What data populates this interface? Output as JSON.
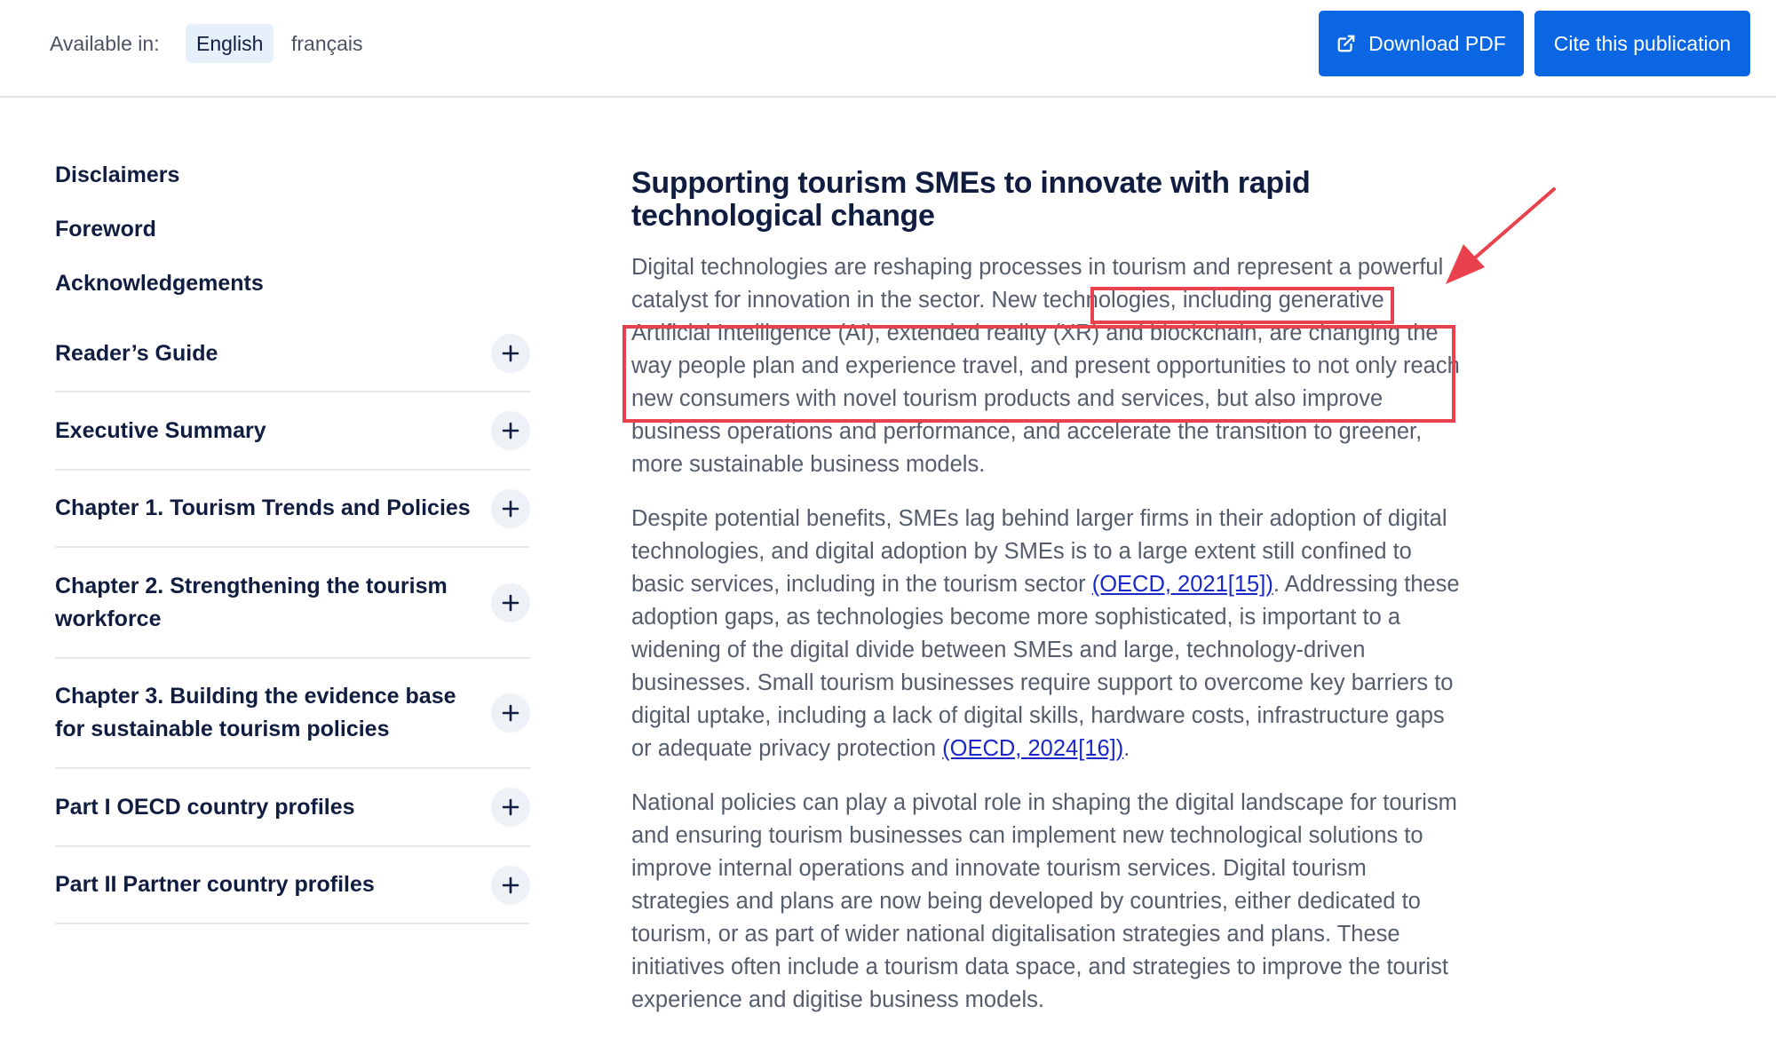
{
  "header": {
    "available_label": "Available in:",
    "languages": [
      "English",
      "français"
    ],
    "download_label": "Download PDF",
    "cite_label": "Cite this publication",
    "accent_color": "#0b66e4"
  },
  "sidebar": {
    "simple_items": [
      "Disclaimers",
      "Foreword",
      "Acknowledgements"
    ],
    "expandable_items": [
      "Reader’s Guide",
      "Executive Summary",
      "Chapter 1. Tourism Trends and Policies",
      "Chapter 2. Strengthening the tourism workforce",
      "Chapter 3. Building the evidence base for sustainable tourism policies",
      "Part I OECD country profiles",
      "Part II Partner country profiles"
    ],
    "expand_icon": "plus-icon"
  },
  "article": {
    "title": "Supporting tourism SMEs to innovate with rapid technological change",
    "p1": "Digital technologies are reshaping processes in tourism and represent a powerful catalyst for innovation in the sector. New technologies, including generative Artificial Intelligence (AI), extended reality (XR) and blockchain, are changing the way people plan and experience travel, and present opportunities to not only reach new consumers with novel tourism products and services, but also improve business operations and performance, and accelerate the transition to greener, more sustainable business models.",
    "p2_a": "Despite potential benefits, SMEs lag behind larger firms in their adoption of digital technologies, and digital adoption by SMEs is to a large extent still confined to basic services, including in the tourism sector ",
    "p2_link1": "(OECD, 2021[15])",
    "p2_b": ". Addressing these adoption gaps, as technologies become more sophisticated, is important to a widening of the digital divide between SMEs and large, technology-driven businesses. Small tourism businesses require support to overcome key barriers to digital uptake, including a lack of digital skills, hardware costs, infrastructure gaps or adequate privacy protection ",
    "p2_link2": "(OECD, 2024[16])",
    "p2_c": ".",
    "p3": "National policies can play a pivotal role in shaping the digital landscape for tourism and ensuring tourism businesses can implement new technological solutions to improve internal operations and innovate tourism services. Digital tourism strategies and plans are now being developed by countries, either dedicated to tourism, or as part of wider national digitalisation strategies and plans. These initiatives often include a tourism data space, and strategies to improve the tourist experience and digitise business models.",
    "annotation_color": "#e9424e"
  }
}
